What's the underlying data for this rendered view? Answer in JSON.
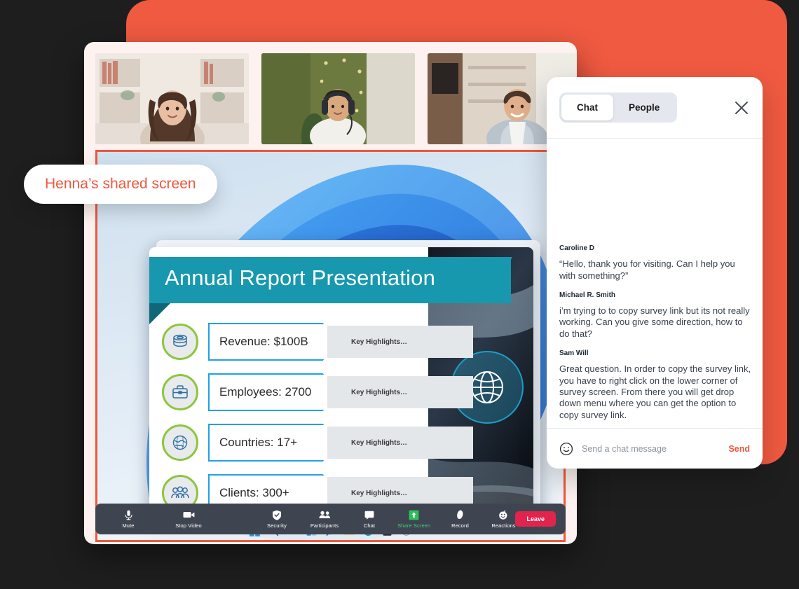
{
  "colors": {
    "page_background": "#1f1e1e",
    "coral_panel": "#F05A41",
    "accent_coral": "#F0573D",
    "zoom_bar": "#3F4550",
    "leave_button": "#E0244E",
    "share_screen_green": "#3ED07A",
    "slide_teal": "#1798AF",
    "slide_blue": "#1FA2E8",
    "slide_green_ring": "#8CC63E"
  },
  "share_label": {
    "text": "Henna’s shared screen"
  },
  "gallery": {
    "tiles": [
      {
        "name": "participant-tile-1",
        "alt": "woman with curly hair in front of bookshelf"
      },
      {
        "name": "participant-tile-2",
        "alt": "person wearing headphones with green wall"
      },
      {
        "name": "participant-tile-3",
        "alt": "man in denim shirt in living room"
      }
    ]
  },
  "slide": {
    "title": "Annual Report Presentation",
    "rows": [
      {
        "icon": "coins-stack-icon",
        "label": "Revenue: $100B",
        "note": "Key Highlights…"
      },
      {
        "icon": "briefcase-icon",
        "label": "Employees: 2700",
        "note": "Key Highlights…"
      },
      {
        "icon": "globe-map-icon",
        "label": "Countries: 17+",
        "note": "Key Highlights…"
      },
      {
        "icon": "people-group-icon",
        "label": "Clients: 300+",
        "note": "Key Highlights…"
      }
    ],
    "globe_badge": "globe-icon"
  },
  "taskbar": {
    "icons": [
      "windows-start-icon",
      "search-icon",
      "task-view-icon",
      "widgets-icon",
      "chat-icon",
      "file-explorer-icon",
      "edge-browser-icon",
      "microsoft-store-icon",
      "paint-icon"
    ],
    "overflow": "chevron-up-icon"
  },
  "zoom_toolbar": {
    "items": [
      {
        "icon": "microphone-icon",
        "label": "Mute",
        "highlight": false
      },
      {
        "icon": "video-camera-icon",
        "label": "Stop Video",
        "highlight": false
      },
      {
        "icon": "shield-check-icon",
        "label": "Security",
        "highlight": false
      },
      {
        "icon": "people-icon",
        "label": "Participants",
        "highlight": false
      },
      {
        "icon": "chat-bubble-icon",
        "label": "Chat",
        "highlight": false
      },
      {
        "icon": "share-screen-icon",
        "label": "Share Screen",
        "highlight": true
      },
      {
        "icon": "record-icon",
        "label": "Record",
        "highlight": false
      },
      {
        "icon": "reactions-icon",
        "label": "Reactions",
        "highlight": false
      }
    ],
    "leave_label": "Leave"
  },
  "chat": {
    "tabs": [
      {
        "label": "Chat",
        "active": true
      },
      {
        "label": "People",
        "active": false
      }
    ],
    "close_icon": "close-icon",
    "messages": [
      {
        "author": "Caroline D",
        "text": "“Hello, thank you for visiting. Can I help you with something?”"
      },
      {
        "author": "Michael R. Smith",
        "text": "i’m trying to to copy survey link but its not really working. Can you give some direction, how to do that?"
      },
      {
        "author": "Sam Will",
        "text": "Great question. In order to copy the survey link, you have to right click on the lower corner of survey screen. From there you will get drop down menu where you can get the option to copy survey link."
      }
    ],
    "composer": {
      "emoji_icon": "smiley-face-icon",
      "placeholder": "Send a chat message",
      "send_label": "Send"
    }
  }
}
